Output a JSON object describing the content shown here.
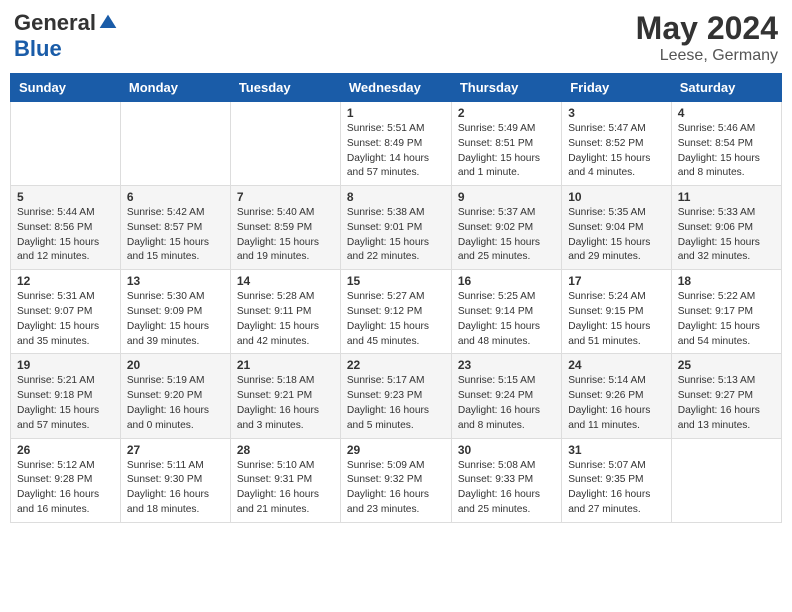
{
  "logo": {
    "general": "General",
    "blue": "Blue"
  },
  "header": {
    "month_year": "May 2024",
    "location": "Leese, Germany"
  },
  "weekdays": [
    "Sunday",
    "Monday",
    "Tuesday",
    "Wednesday",
    "Thursday",
    "Friday",
    "Saturday"
  ],
  "weeks": [
    [
      {
        "day": null,
        "info": null
      },
      {
        "day": null,
        "info": null
      },
      {
        "day": null,
        "info": null
      },
      {
        "day": "1",
        "info": "Sunrise: 5:51 AM\nSunset: 8:49 PM\nDaylight: 14 hours\nand 57 minutes."
      },
      {
        "day": "2",
        "info": "Sunrise: 5:49 AM\nSunset: 8:51 PM\nDaylight: 15 hours\nand 1 minute."
      },
      {
        "day": "3",
        "info": "Sunrise: 5:47 AM\nSunset: 8:52 PM\nDaylight: 15 hours\nand 4 minutes."
      },
      {
        "day": "4",
        "info": "Sunrise: 5:46 AM\nSunset: 8:54 PM\nDaylight: 15 hours\nand 8 minutes."
      }
    ],
    [
      {
        "day": "5",
        "info": "Sunrise: 5:44 AM\nSunset: 8:56 PM\nDaylight: 15 hours\nand 12 minutes."
      },
      {
        "day": "6",
        "info": "Sunrise: 5:42 AM\nSunset: 8:57 PM\nDaylight: 15 hours\nand 15 minutes."
      },
      {
        "day": "7",
        "info": "Sunrise: 5:40 AM\nSunset: 8:59 PM\nDaylight: 15 hours\nand 19 minutes."
      },
      {
        "day": "8",
        "info": "Sunrise: 5:38 AM\nSunset: 9:01 PM\nDaylight: 15 hours\nand 22 minutes."
      },
      {
        "day": "9",
        "info": "Sunrise: 5:37 AM\nSunset: 9:02 PM\nDaylight: 15 hours\nand 25 minutes."
      },
      {
        "day": "10",
        "info": "Sunrise: 5:35 AM\nSunset: 9:04 PM\nDaylight: 15 hours\nand 29 minutes."
      },
      {
        "day": "11",
        "info": "Sunrise: 5:33 AM\nSunset: 9:06 PM\nDaylight: 15 hours\nand 32 minutes."
      }
    ],
    [
      {
        "day": "12",
        "info": "Sunrise: 5:31 AM\nSunset: 9:07 PM\nDaylight: 15 hours\nand 35 minutes."
      },
      {
        "day": "13",
        "info": "Sunrise: 5:30 AM\nSunset: 9:09 PM\nDaylight: 15 hours\nand 39 minutes."
      },
      {
        "day": "14",
        "info": "Sunrise: 5:28 AM\nSunset: 9:11 PM\nDaylight: 15 hours\nand 42 minutes."
      },
      {
        "day": "15",
        "info": "Sunrise: 5:27 AM\nSunset: 9:12 PM\nDaylight: 15 hours\nand 45 minutes."
      },
      {
        "day": "16",
        "info": "Sunrise: 5:25 AM\nSunset: 9:14 PM\nDaylight: 15 hours\nand 48 minutes."
      },
      {
        "day": "17",
        "info": "Sunrise: 5:24 AM\nSunset: 9:15 PM\nDaylight: 15 hours\nand 51 minutes."
      },
      {
        "day": "18",
        "info": "Sunrise: 5:22 AM\nSunset: 9:17 PM\nDaylight: 15 hours\nand 54 minutes."
      }
    ],
    [
      {
        "day": "19",
        "info": "Sunrise: 5:21 AM\nSunset: 9:18 PM\nDaylight: 15 hours\nand 57 minutes."
      },
      {
        "day": "20",
        "info": "Sunrise: 5:19 AM\nSunset: 9:20 PM\nDaylight: 16 hours\nand 0 minutes."
      },
      {
        "day": "21",
        "info": "Sunrise: 5:18 AM\nSunset: 9:21 PM\nDaylight: 16 hours\nand 3 minutes."
      },
      {
        "day": "22",
        "info": "Sunrise: 5:17 AM\nSunset: 9:23 PM\nDaylight: 16 hours\nand 5 minutes."
      },
      {
        "day": "23",
        "info": "Sunrise: 5:15 AM\nSunset: 9:24 PM\nDaylight: 16 hours\nand 8 minutes."
      },
      {
        "day": "24",
        "info": "Sunrise: 5:14 AM\nSunset: 9:26 PM\nDaylight: 16 hours\nand 11 minutes."
      },
      {
        "day": "25",
        "info": "Sunrise: 5:13 AM\nSunset: 9:27 PM\nDaylight: 16 hours\nand 13 minutes."
      }
    ],
    [
      {
        "day": "26",
        "info": "Sunrise: 5:12 AM\nSunset: 9:28 PM\nDaylight: 16 hours\nand 16 minutes."
      },
      {
        "day": "27",
        "info": "Sunrise: 5:11 AM\nSunset: 9:30 PM\nDaylight: 16 hours\nand 18 minutes."
      },
      {
        "day": "28",
        "info": "Sunrise: 5:10 AM\nSunset: 9:31 PM\nDaylight: 16 hours\nand 21 minutes."
      },
      {
        "day": "29",
        "info": "Sunrise: 5:09 AM\nSunset: 9:32 PM\nDaylight: 16 hours\nand 23 minutes."
      },
      {
        "day": "30",
        "info": "Sunrise: 5:08 AM\nSunset: 9:33 PM\nDaylight: 16 hours\nand 25 minutes."
      },
      {
        "day": "31",
        "info": "Sunrise: 5:07 AM\nSunset: 9:35 PM\nDaylight: 16 hours\nand 27 minutes."
      },
      {
        "day": null,
        "info": null
      }
    ]
  ]
}
